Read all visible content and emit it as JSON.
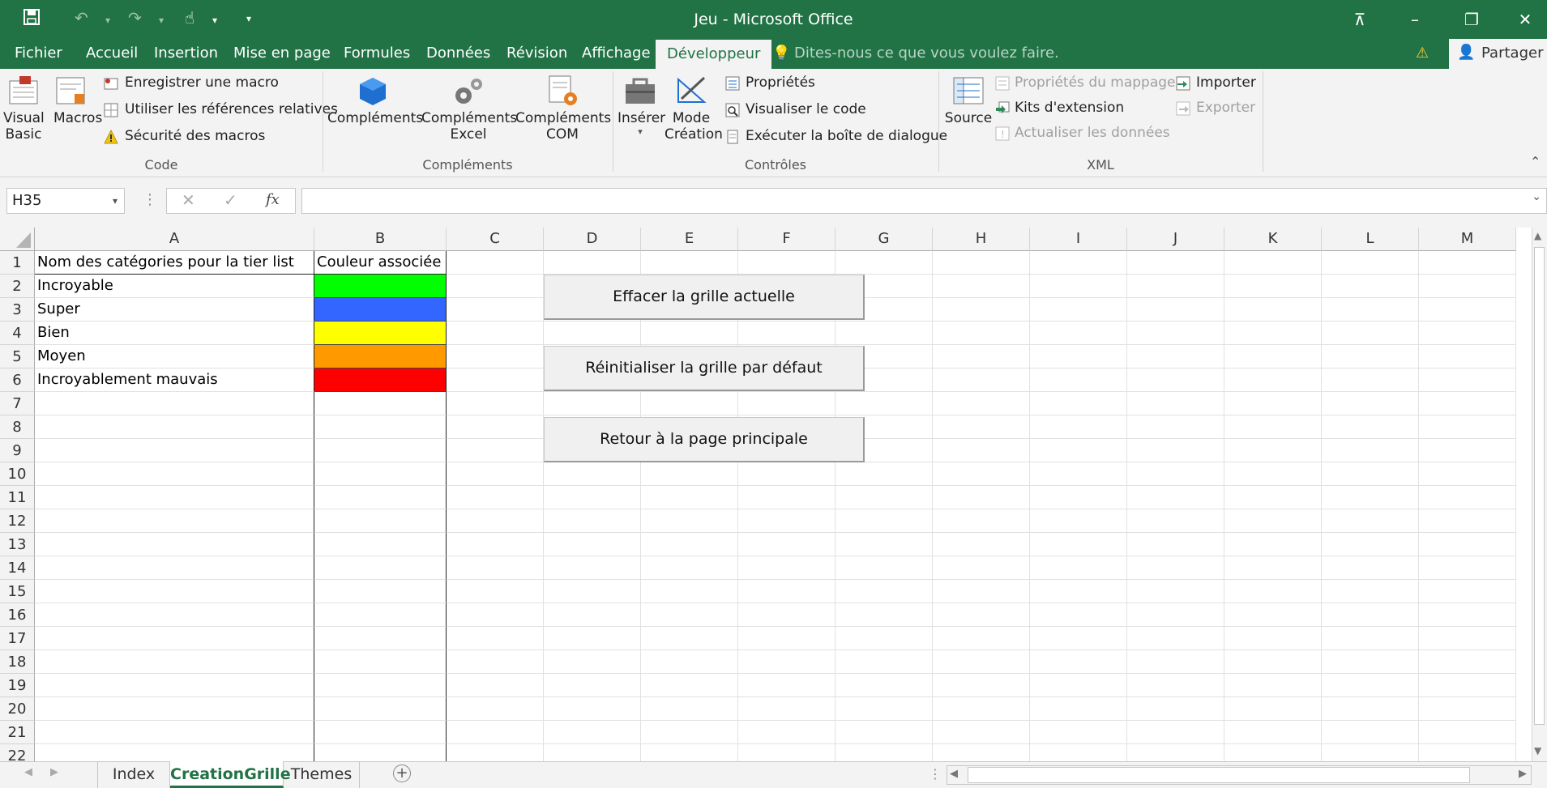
{
  "window": {
    "title": "Jeu - Microsoft Office"
  },
  "tabs": [
    "Fichier",
    "Accueil",
    "Insertion",
    "Mise en page",
    "Formules",
    "Données",
    "Révision",
    "Affichage",
    "Développeur"
  ],
  "active_tab": "Développeur",
  "tell_me": "Dites-nous ce que vous voulez faire.",
  "share": "Partager",
  "ribbon": {
    "code": {
      "visual_basic": [
        "Visual",
        "Basic"
      ],
      "macros": "Macros",
      "record": "Enregistrer une macro",
      "relative": "Utiliser les références relatives",
      "security": "Sécurité des macros",
      "group": "Code"
    },
    "addins": {
      "complements": "Compléments",
      "excel": [
        "Compléments",
        "Excel"
      ],
      "com": [
        "Compléments",
        "COM"
      ],
      "group": "Compléments"
    },
    "controls": {
      "insert": "Insérer",
      "mode": [
        "Mode",
        "Création"
      ],
      "properties": "Propriétés",
      "view_code": "Visualiser le code",
      "run_dialog": "Exécuter la boîte de dialogue",
      "group": "Contrôles"
    },
    "xml": {
      "source": "Source",
      "map_props": "Propriétés du mappage",
      "expansion": "Kits d'extension",
      "refresh": "Actualiser les données",
      "import": "Importer",
      "export": "Exporter",
      "group": "XML"
    }
  },
  "name_box": "H35",
  "formula_icons": {
    "cancel": "✕",
    "enter": "✓",
    "fx": "fx"
  },
  "columns": [
    "A",
    "B",
    "C",
    "D",
    "E",
    "F",
    "G",
    "H",
    "I",
    "J",
    "K",
    "L",
    "M"
  ],
  "rows": [
    "1",
    "2",
    "3",
    "4",
    "5",
    "6",
    "7",
    "8",
    "9",
    "10",
    "11",
    "12",
    "13",
    "14",
    "15",
    "16",
    "17",
    "18",
    "19",
    "20",
    "21",
    "22"
  ],
  "cells": {
    "A1": "Nom des catégories pour la tier list",
    "B1": "Couleur associée",
    "A2": "Incroyable",
    "A3": "Super",
    "A4": "Bien",
    "A5": "Moyen",
    "A6": "Incroyablement mauvais"
  },
  "tier_colors": [
    "#00ff00",
    "#3366ff",
    "#ffff00",
    "#ff9900",
    "#ff0000"
  ],
  "buttons": {
    "clear": "Effacer la grille actuelle",
    "reset": "Réinitialiser la grille par défaut",
    "back": "Retour à la page principale"
  },
  "sheets": [
    "Index",
    "CreationGrille",
    "Themes"
  ],
  "active_sheet": "CreationGrille",
  "colors": {
    "excel_green": "#217346",
    "ribbon_bg": "#f3f3f3"
  }
}
